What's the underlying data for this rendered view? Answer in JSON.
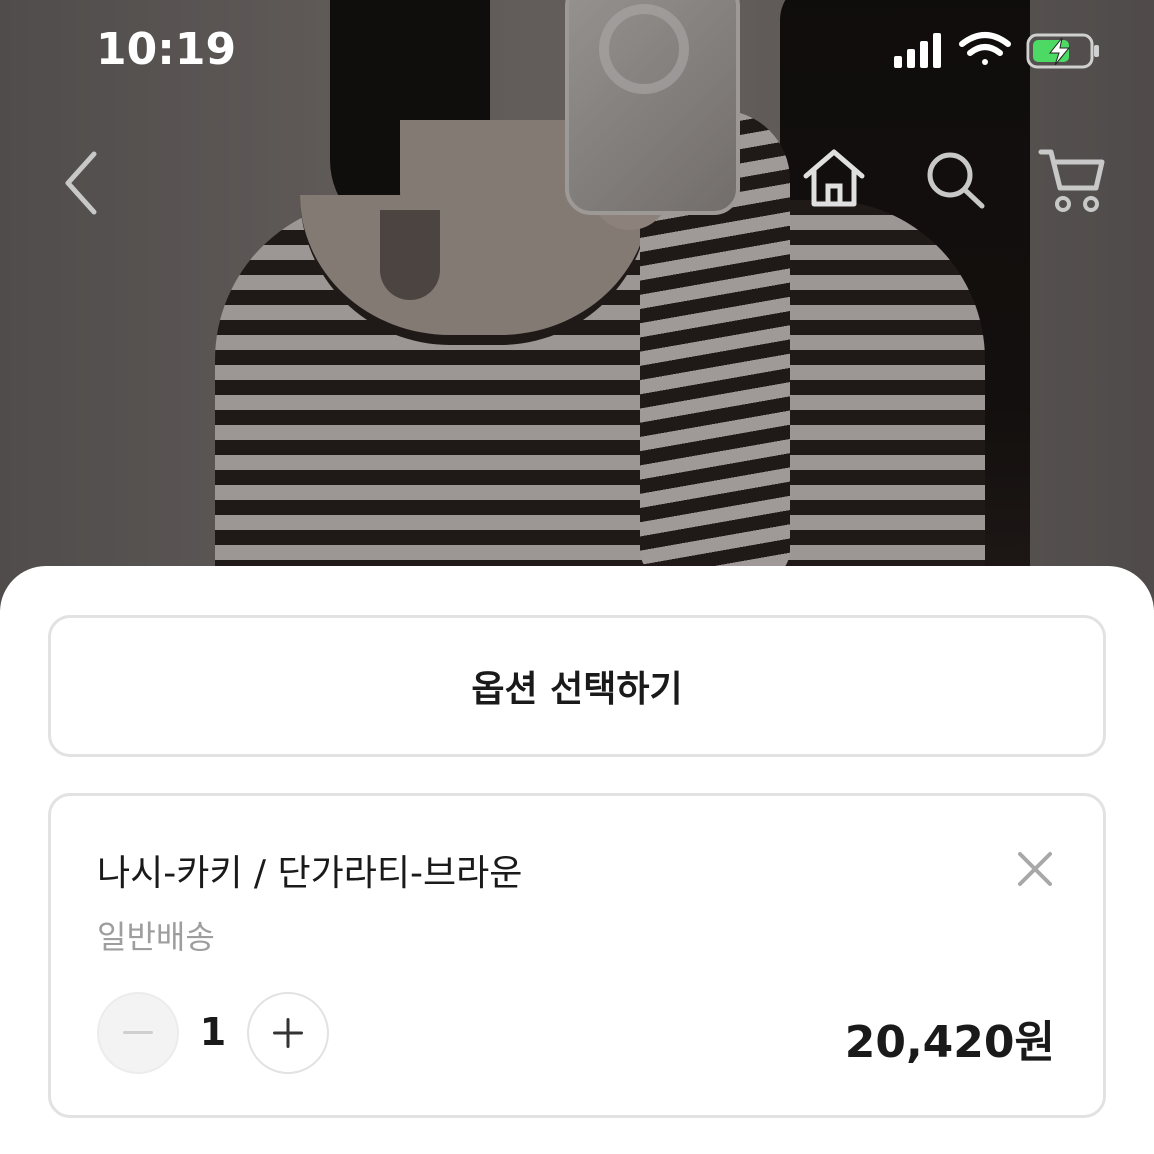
{
  "status_bar": {
    "time": "10:19",
    "icons": [
      "cellular-signal-icon",
      "wifi-icon",
      "battery-charging-icon"
    ]
  },
  "nav": {
    "icons": [
      "back-chevron-icon",
      "home-icon",
      "search-icon",
      "cart-icon"
    ]
  },
  "sheet": {
    "option_button_label": "옵션 선택하기",
    "item": {
      "name": "나시-카키 / 단가라티-브라운",
      "shipping": "일반배송",
      "quantity": "1",
      "price": "20,420원"
    }
  },
  "colors": {
    "sheet_background": "#ffffff",
    "border": "#e2e2e2",
    "text_primary": "#1a1a1a",
    "text_secondary": "#9e9e9e"
  }
}
